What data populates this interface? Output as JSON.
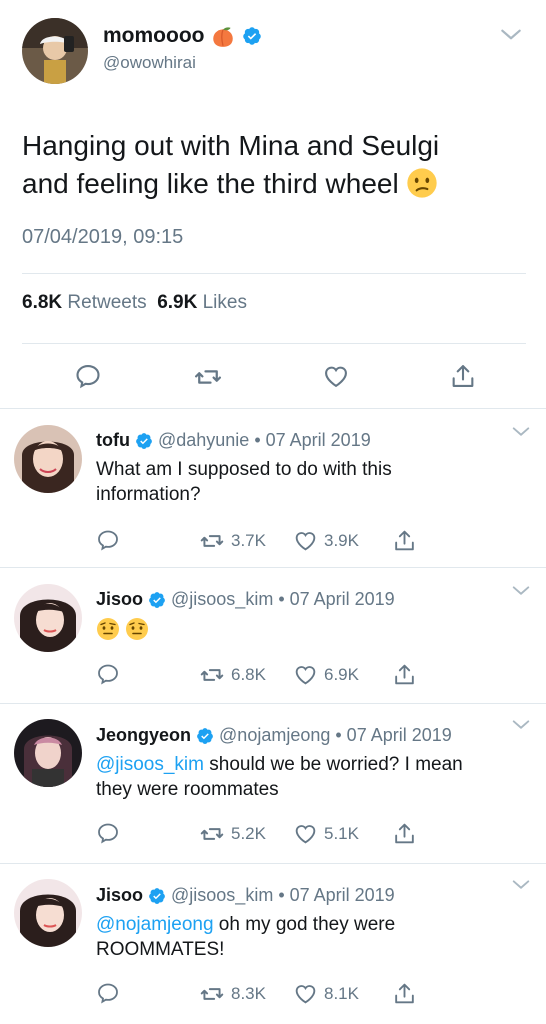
{
  "main_tweet": {
    "display_name": "momoooo",
    "name_emoji": "peach-emoji",
    "handle": "@owowhirai",
    "text_line1": "Hanging out with Mina and Seulgi",
    "text_line2": "and feeling like the third wheel",
    "text_emoji": "confused-face-emoji",
    "timestamp": "07/04/2019, 09:15",
    "retweets_count": "6.8K",
    "retweets_label": "Retweets",
    "likes_count": "6.9K",
    "likes_label": "Likes"
  },
  "replies": [
    {
      "name": "tofu",
      "handle": "@dahyunie",
      "date": "• 07 April 2019",
      "text_line1": "What am I supposed to do with this",
      "text_line2": "information?",
      "retweets": "3.7K",
      "likes": "3.9K"
    },
    {
      "name": "Jisoo",
      "handle": "@jisoos_kim",
      "date": "• 07 April 2019",
      "text_emojis": [
        "face-with-raised-eyebrow-emoji",
        "face-with-raised-eyebrow-emoji"
      ],
      "retweets": "6.8K",
      "likes": "6.9K"
    },
    {
      "name": "Jeongyeon",
      "handle": "@nojamjeong",
      "date": "• 07 April 2019",
      "mention": "@jisoos_kim",
      "text_line1_rest": " should we be worried? I mean",
      "text_line2": "they were roommates",
      "retweets": "5.2K",
      "likes": "5.1K"
    },
    {
      "name": "Jisoo",
      "handle": "@jisoos_kim",
      "date": "• 07 April 2019",
      "mention": "@nojamjeong",
      "text_line1_rest": " oh my god they were",
      "text_line2": "ROOMMATES!",
      "retweets": "8.3K",
      "likes": "8.1K"
    }
  ],
  "colors": {
    "text": "#14171a",
    "secondary": "#657786",
    "accent": "#1da1f2",
    "divider": "#e1e8ed"
  }
}
